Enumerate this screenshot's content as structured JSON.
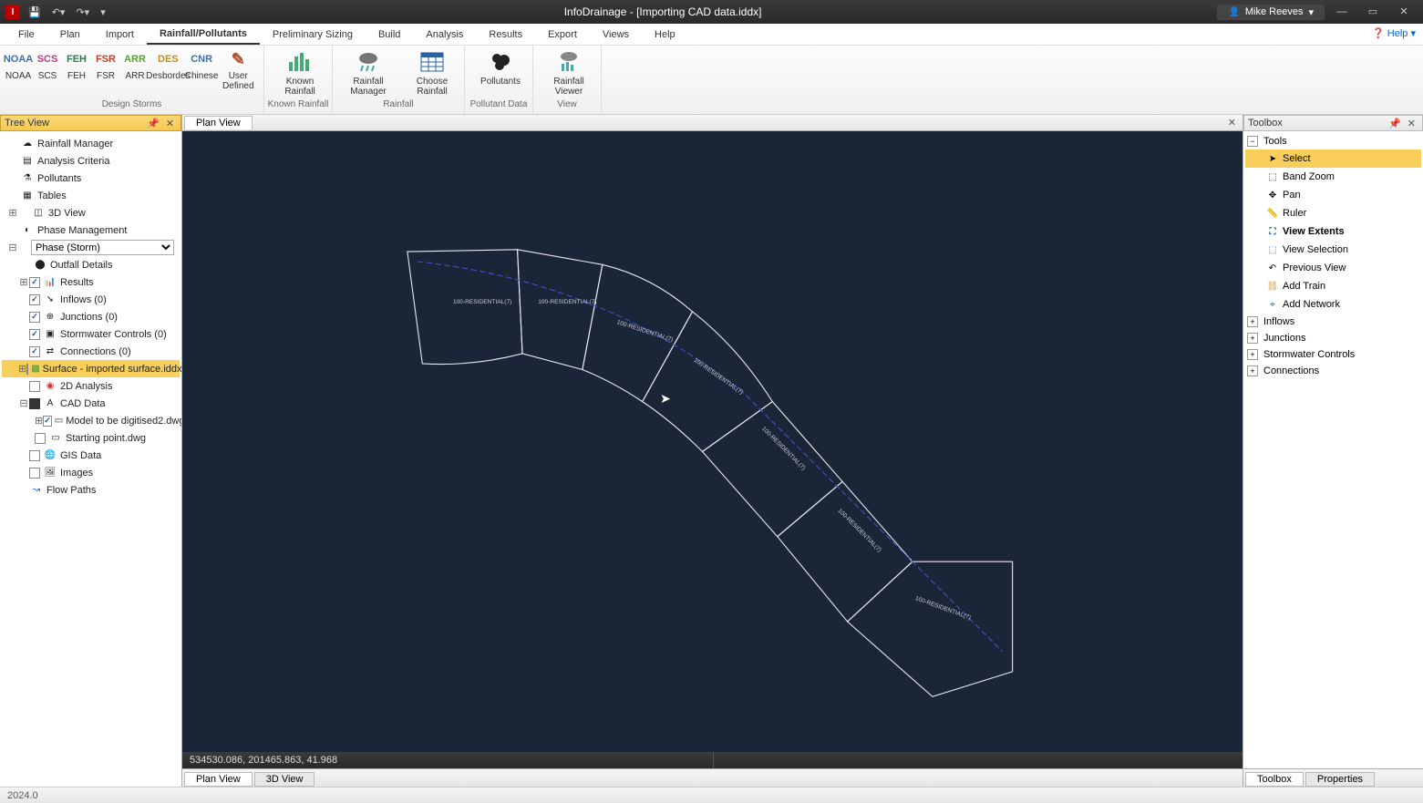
{
  "title": "InfoDrainage - [Importing CAD data.iddx]",
  "user": "Mike Reeves",
  "menu": [
    "File",
    "Plan",
    "Import",
    "Rainfall/Pollutants",
    "Preliminary Sizing",
    "Build",
    "Analysis",
    "Results",
    "Export",
    "Views",
    "Help"
  ],
  "menu_active": "Rainfall/Pollutants",
  "help_link": "Help",
  "ribbon": {
    "design_storms": {
      "label": "Design Storms",
      "items": [
        {
          "abbr": "NOAA",
          "name": "NOAA",
          "color": "#3a6fb0"
        },
        {
          "abbr": "SCS",
          "name": "SCS",
          "color": "#c03a7a"
        },
        {
          "abbr": "FEH",
          "name": "FEH",
          "color": "#2d7a4e"
        },
        {
          "abbr": "FSR",
          "name": "FSR",
          "color": "#c93a2a"
        },
        {
          "abbr": "ARR",
          "name": "ARR",
          "color": "#5aa32d"
        },
        {
          "abbr": "DES",
          "name": "Desbordes",
          "color": "#c98a1a"
        },
        {
          "abbr": "CNR",
          "name": "Chinese",
          "color": "#3a6fb0"
        },
        {
          "abbr": "✎",
          "name": "User Defined",
          "color": "#b0522d"
        }
      ]
    },
    "known_rainfall": {
      "label": "Known Rainfall",
      "items": [
        {
          "name": "Known Rainfall"
        }
      ]
    },
    "rainfall": {
      "label": "Rainfall",
      "items": [
        {
          "name": "Rainfall Manager"
        },
        {
          "name": "Choose Rainfall"
        }
      ]
    },
    "pollutant": {
      "label": "Pollutant Data",
      "items": [
        {
          "name": "Pollutants"
        }
      ]
    },
    "view": {
      "label": "View",
      "items": [
        {
          "name": "Rainfall Viewer"
        }
      ]
    }
  },
  "tree_header": "Tree View",
  "tree": {
    "rainfall_manager": "Rainfall Manager",
    "analysis_criteria": "Analysis Criteria",
    "pollutants": "Pollutants",
    "tables": "Tables",
    "view3d": "3D View",
    "phase_management": "Phase Management",
    "phase_selected": "Phase (Storm)",
    "outfall_details": "Outfall Details",
    "results": "Results",
    "inflows": "Inflows (0)",
    "junctions": "Junctions (0)",
    "stormwater": "Stormwater Controls (0)",
    "connections": "Connections (0)",
    "surface": "Surface - imported surface.iddx",
    "analysis2d": "2D Analysis",
    "cad_data": "CAD Data",
    "model_dwg": "Model to be digitised2.dwg",
    "starting_dwg": "Starting point.dwg",
    "gis_data": "GIS Data",
    "images": "Images",
    "flow_paths": "Flow Paths"
  },
  "plan_tab": "Plan View",
  "coords": "534530.086, 201465.863, 41.968",
  "bottom_tabs": [
    "Plan View",
    "3D View"
  ],
  "toolbox": {
    "header": "Toolbox",
    "sections": {
      "tools": "Tools",
      "inflows": "Inflows",
      "junctions": "Junctions",
      "stormwater": "Stormwater Controls",
      "connections": "Connections"
    },
    "tools": [
      {
        "label": "Select",
        "selected": true
      },
      {
        "label": "Band Zoom"
      },
      {
        "label": "Pan"
      },
      {
        "label": "Ruler"
      },
      {
        "label": "View Extents",
        "bold": true
      },
      {
        "label": "View Selection"
      },
      {
        "label": "Previous View"
      },
      {
        "label": "Add Train"
      },
      {
        "label": "Add Network"
      }
    ]
  },
  "right_tabs": [
    "Toolbox",
    "Properties"
  ],
  "status_version": "2024.0",
  "cad_labels": [
    "100-RESIDENTIAL(7)",
    "100-RESIDENTIAL(7)",
    "100-RESIDENTIAL(7)",
    "100-RESIDENTIAL(7)",
    "100-RESIDENTIAL(7)",
    "100-RESIDENTIAL(7)",
    "100-RESIDENTIAL(7)"
  ]
}
